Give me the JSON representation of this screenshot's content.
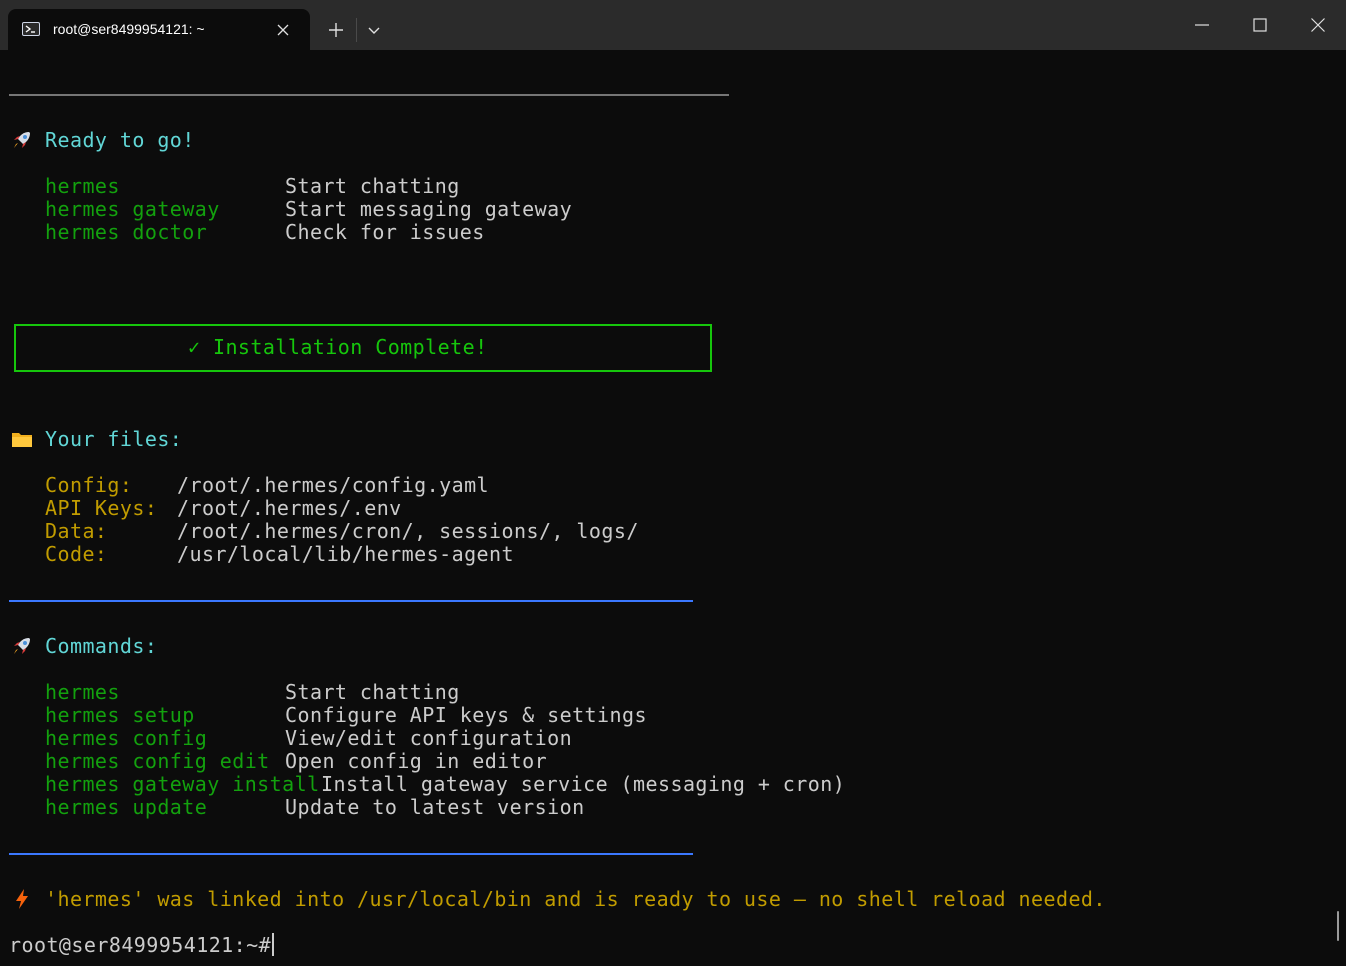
{
  "window": {
    "tab_title": "root@ser8499954121: ~"
  },
  "ready": {
    "heading": "Ready to go!",
    "rows": [
      {
        "cmd": "hermes",
        "desc": "Start chatting"
      },
      {
        "cmd": "hermes gateway",
        "desc": "Start messaging gateway"
      },
      {
        "cmd": "hermes doctor",
        "desc": "Check for issues"
      }
    ]
  },
  "install": {
    "banner": "✓ Installation Complete!"
  },
  "files": {
    "heading": "Your files:",
    "rows": [
      {
        "label": "Config:",
        "value": "/root/.hermes/config.yaml"
      },
      {
        "label": "API Keys:",
        "value": "/root/.hermes/.env"
      },
      {
        "label": "Data:",
        "value": "/root/.hermes/cron/, sessions/, logs/"
      },
      {
        "label": "Code:",
        "value": "/usr/local/lib/hermes-agent"
      }
    ]
  },
  "commands": {
    "heading": "Commands:",
    "rows": [
      {
        "cmd": "hermes",
        "desc": "Start chatting"
      },
      {
        "cmd": "hermes setup",
        "desc": "Configure API keys & settings"
      },
      {
        "cmd": "hermes config",
        "desc": "View/edit configuration"
      },
      {
        "cmd": "hermes config edit",
        "desc": "Open config in editor"
      },
      {
        "cmd": "hermes gateway install",
        "desc": "Install gateway service (messaging + cron)"
      },
      {
        "cmd": "hermes update",
        "desc": "Update to latest version"
      }
    ]
  },
  "notice": {
    "text": "'hermes' was linked into /usr/local/bin and is ready to use — no shell reload needed."
  },
  "prompt": {
    "text": "root@ser8499954121:~#"
  },
  "icons": {
    "tab": "powershell-terminal-icon",
    "ready": "rocket-icon",
    "files": "folder-icon",
    "commands": "rocket-icon",
    "notice": "lightning-icon"
  },
  "colors": {
    "background": "#0c0c0c",
    "heading_cyan": "#61d6d6",
    "command_green": "#13a10e",
    "label_yellow": "#c19c00",
    "banner_green": "#16c60c",
    "rule_blue": "#3b78ff"
  }
}
